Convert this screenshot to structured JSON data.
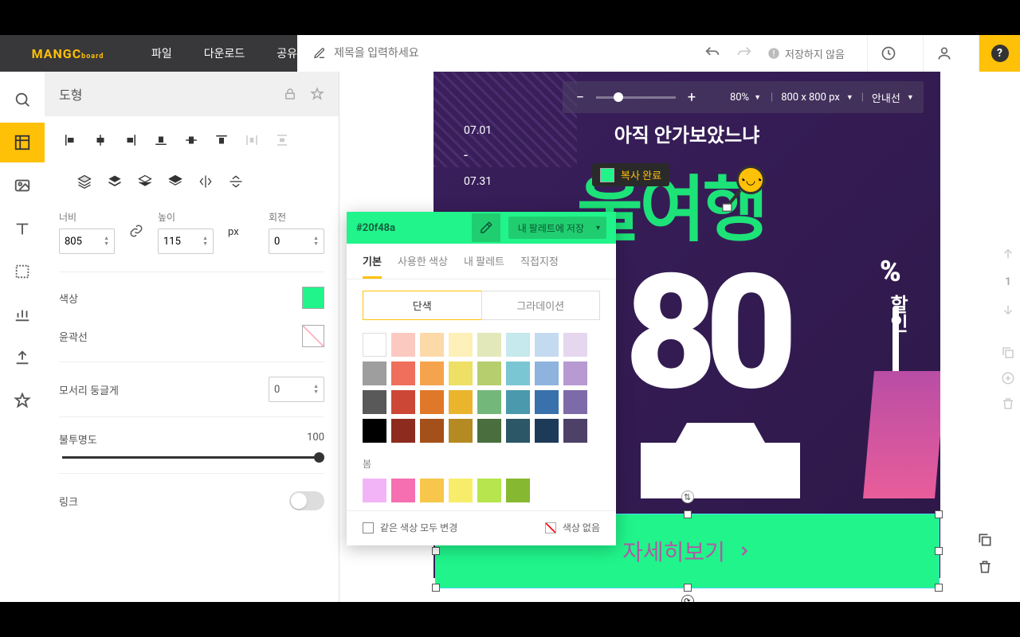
{
  "brand": {
    "name": "MANGC",
    "suffix": "board"
  },
  "menu": {
    "file": "파일",
    "download": "다운로드",
    "share": "공유"
  },
  "toolbar": {
    "title_placeholder": "제목을 입력하세요",
    "save_status": "저장하지 않음"
  },
  "canvas_controls": {
    "zoom_value": "80%",
    "size_value": "800 x 800 px",
    "guide_label": "안내선"
  },
  "props": {
    "panel_title": "도형",
    "width_label": "너비",
    "height_label": "높이",
    "rotation_label": "회전",
    "width_value": "805",
    "height_value": "115",
    "rotation_value": "0",
    "px": "px",
    "color_label": "색상",
    "outline_label": "윤곽선",
    "round_label": "모서리 둥글게",
    "round_value": "0",
    "opacity_label": "불투명도",
    "opacity_value": "100",
    "link_label": "링크"
  },
  "copy_tooltip": "복사 완료",
  "design": {
    "date_start": "07.01",
    "date_end": "07.31",
    "subtitle": "아직 안가보았느냐",
    "title": "울여행",
    "big_number": "80",
    "percent": "%",
    "discount": "할인",
    "cta": "자세히보기"
  },
  "color_popover": {
    "hex": "#20f48a",
    "save_palette": "내 팔레트에 저장",
    "tabs": [
      "기본",
      "사용한 색상",
      "내 팔레트",
      "직접지정"
    ],
    "subtabs": [
      "단색",
      "그라데이션"
    ],
    "section_label": "봄",
    "change_all": "같은 색상 모두 변경",
    "no_color": "색상 없음",
    "grid": [
      "#ffffff",
      "#fcc9c0",
      "#fcd9a8",
      "#fdf0b8",
      "#e2e8b9",
      "#c5e9ed",
      "#c4daf1",
      "#e5d7ee",
      "#9e9e9e",
      "#ee6f5c",
      "#f5a44d",
      "#ede064",
      "#b6ce6d",
      "#7bc6d3",
      "#8eb3de",
      "#b69ad1",
      "#595959",
      "#cd4737",
      "#e0782a",
      "#eab52c",
      "#74b77a",
      "#4a99ac",
      "#3871ab",
      "#7d6aa9",
      "#000000",
      "#8e2b1f",
      "#a4501a",
      "#b68a22",
      "#4a6e3e",
      "#2c5766",
      "#1e3a59",
      "#4e4168"
    ],
    "row2": [
      "#f3b4f7",
      "#f66fb0",
      "#f7c64a",
      "#f8ed6a",
      "#b7e54d",
      "#86b831"
    ]
  },
  "right_page": "1"
}
